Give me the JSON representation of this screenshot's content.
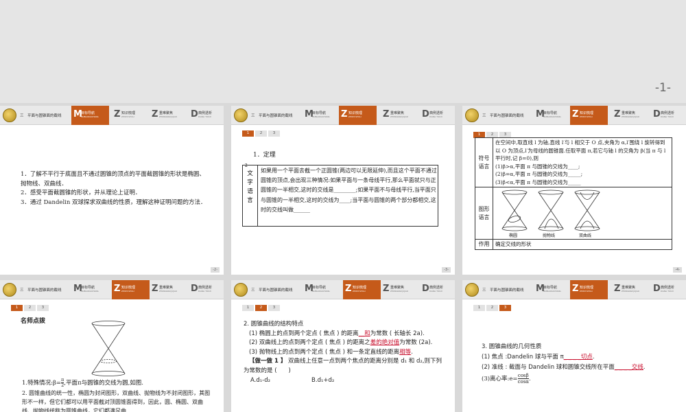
{
  "top_page_number": "-1-",
  "header": {
    "section_title": "三　平面与圆锥面的截线",
    "tabs": [
      {
        "letter": "M",
        "label": "目标导航",
        "sub": "MUBIAODAOHANG"
      },
      {
        "letter": "Z",
        "label": "知识梳理",
        "sub": "ZHISHI SHULI"
      },
      {
        "letter": "Z",
        "label": "重难聚焦",
        "sub": "ZHONGNAN JUJIAO"
      },
      {
        "letter": "D",
        "label": "典例透析",
        "sub": "DIANLI TOUXI"
      }
    ]
  },
  "pager": [
    "1",
    "2",
    "3"
  ],
  "slide1": {
    "page": "-2-",
    "items": [
      "1．了解不平行于底面且不通过圆锥的顶点的平面截圆锥的形状是椭圆、抛物线、双曲线．",
      "2．感受平面截圆锥的形状，并从理论上证明．",
      "3．通过 Dandelin 双球探求双曲线的性质，理解这种证明问题的方法．"
    ]
  },
  "slide2": {
    "page": "-3-",
    "heading": "1．定理",
    "sup": "2",
    "left_label": "文字语言",
    "text": "如果用一个平面去截一个正圆锥(两边可以无限延伸),而且这个平面不通过圆锥的顶点,会出现三种情况:如果平面与一条母线平行,那么平面就只与正圆锥的一半相交,这时的交线是________;如果平面不与母线平行,当平面只与圆锥的一半相交,这时的交线为____;当平面与圆锥的两个部分都相交,这时的交线叫做______"
  },
  "slide3": {
    "page": "-4-",
    "row1_label": "符号语言",
    "row1_lines": [
      "在空间中,取直线 l 为轴,直线 l′与 l 相交于 O 点,夹角为 α,l′围绕 l 旋转得到以 O 为顶点,l′为母线的圆锥面.任取平面 π,若它与轴 l 的交角为 β(当 π 与 l 平行时,记 β=0),则",
      "(1)β>α,平面 π 与圆锥的交线为____;",
      "(2)β=α,平面 π 与圆锥的交线为_____;",
      "(3)β<α,平面 π 与圆锥的交线为_____"
    ],
    "row2_label": "图形语言",
    "figure_labels": [
      "椭圆",
      "抛物线",
      "双曲线"
    ],
    "row3_label": "作用",
    "row3_text": "确定交线的形状"
  },
  "slide4": {
    "title": "名师点拨",
    "line1_pre": "1.特殊情况:β=",
    "line1_frac_num": "π",
    "line1_frac_den": "2",
    "line1_post": ",平面π与圆锥的交线为圆,如图.",
    "line2": "2. 圆锥曲线的统一性，椭圆为封闭图形，双曲线、抛物线为不封闭图形，其图形不一样，但它们都可以用平面截对顶圆锥面得到，因此，圆、椭圆、双曲线、抛物线统称为圆锥曲线，它们都满足曲"
  },
  "slide5": {
    "heading": "2. 圆锥曲线的结构特点",
    "p1_pre": "(1) 椭圆上的点到两个定点 ( 焦点 ) 的距离",
    "p1_red": "__和",
    "p1_post": "为常数 ( 长轴长 2a).",
    "p2_pre": "(2) 双曲线上的点到两个定点 ( 焦点 ) 的距离之",
    "p2_red": "差的绝对值",
    "p2_post": "为常数 (2a).",
    "p3_pre": "(3) 抛物线上的点到两个定点 ( 焦点 ) 和一条定直线的距离",
    "p3_red": "相等",
    "p3_post": ".",
    "practice_label": "【做一做 1 】",
    "practice_text": "双曲线上任意一点到两个焦点的距离分别是 d₁ 和 d₂,则下列为常数的是 (　　)",
    "option_a": "A.d₁-d₂",
    "option_b": "B.d₁+d₂"
  },
  "slide6": {
    "heading": "3. 圆锥曲线的几何性质",
    "p1_pre": "(1) 焦点 :Dandelin 球与平面 π",
    "p1_red": "_ _ _ _切点",
    "p1_post": ".",
    "p2_pre": "(2) 准线 : 截面与 Dandelin 球和圆锥交线所在平面",
    "p2_red": "_ _ _ _交线",
    "p2_post": ".",
    "p3_pre": "(3)离心率:e=",
    "p3_num": "cosβ",
    "p3_den": "cosα",
    "p3_post": "."
  }
}
